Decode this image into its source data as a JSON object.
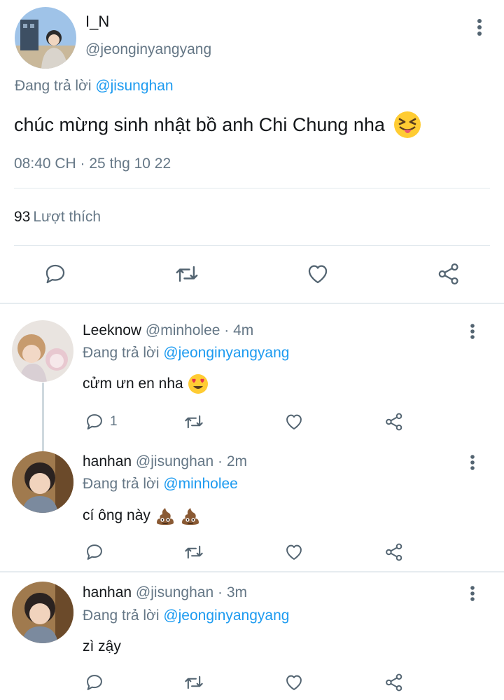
{
  "main_tweet": {
    "name": "I_N",
    "handle": "@jeonginyangyang",
    "replying_prefix": "Đang trả lời",
    "replying_to": "@jisunghan",
    "text": "chúc mừng sinh nhật bồ anh Chi Chung nha",
    "emoji": "squinting-face-with-tongue",
    "timestamp": "08:40 CH · 25 thg 10 22",
    "likes_count": "93",
    "likes_label": "Lượt thích"
  },
  "replies": [
    {
      "name": "Leeknow",
      "handle": "@minholee",
      "time": "· 4m",
      "replying_prefix": "Đang trả lời",
      "replying_to": "@jeonginyangyang",
      "text": "cửm ưn en nha",
      "emojis": [
        "smiling-face-with-heart-eyes"
      ],
      "reply_count": "1"
    },
    {
      "name": "hanhan",
      "handle": "@jisunghan",
      "time": "· 2m",
      "replying_prefix": "Đang trả lời",
      "replying_to": "@minholee",
      "text": "cí ông này",
      "emojis": [
        "pile-of-poo",
        "pile-of-poo"
      ],
      "reply_count": ""
    },
    {
      "name": "hanhan",
      "handle": "@jisunghan",
      "time": "· 3m",
      "replying_prefix": "Đang trả lời",
      "replying_to": "@jeonginyangyang",
      "text": "zì zậy",
      "emojis": [],
      "reply_count": ""
    }
  ],
  "colors": {
    "link_blue": "#1d9bf0",
    "secondary_grey": "#657786",
    "divider": "#e1e8ed"
  }
}
